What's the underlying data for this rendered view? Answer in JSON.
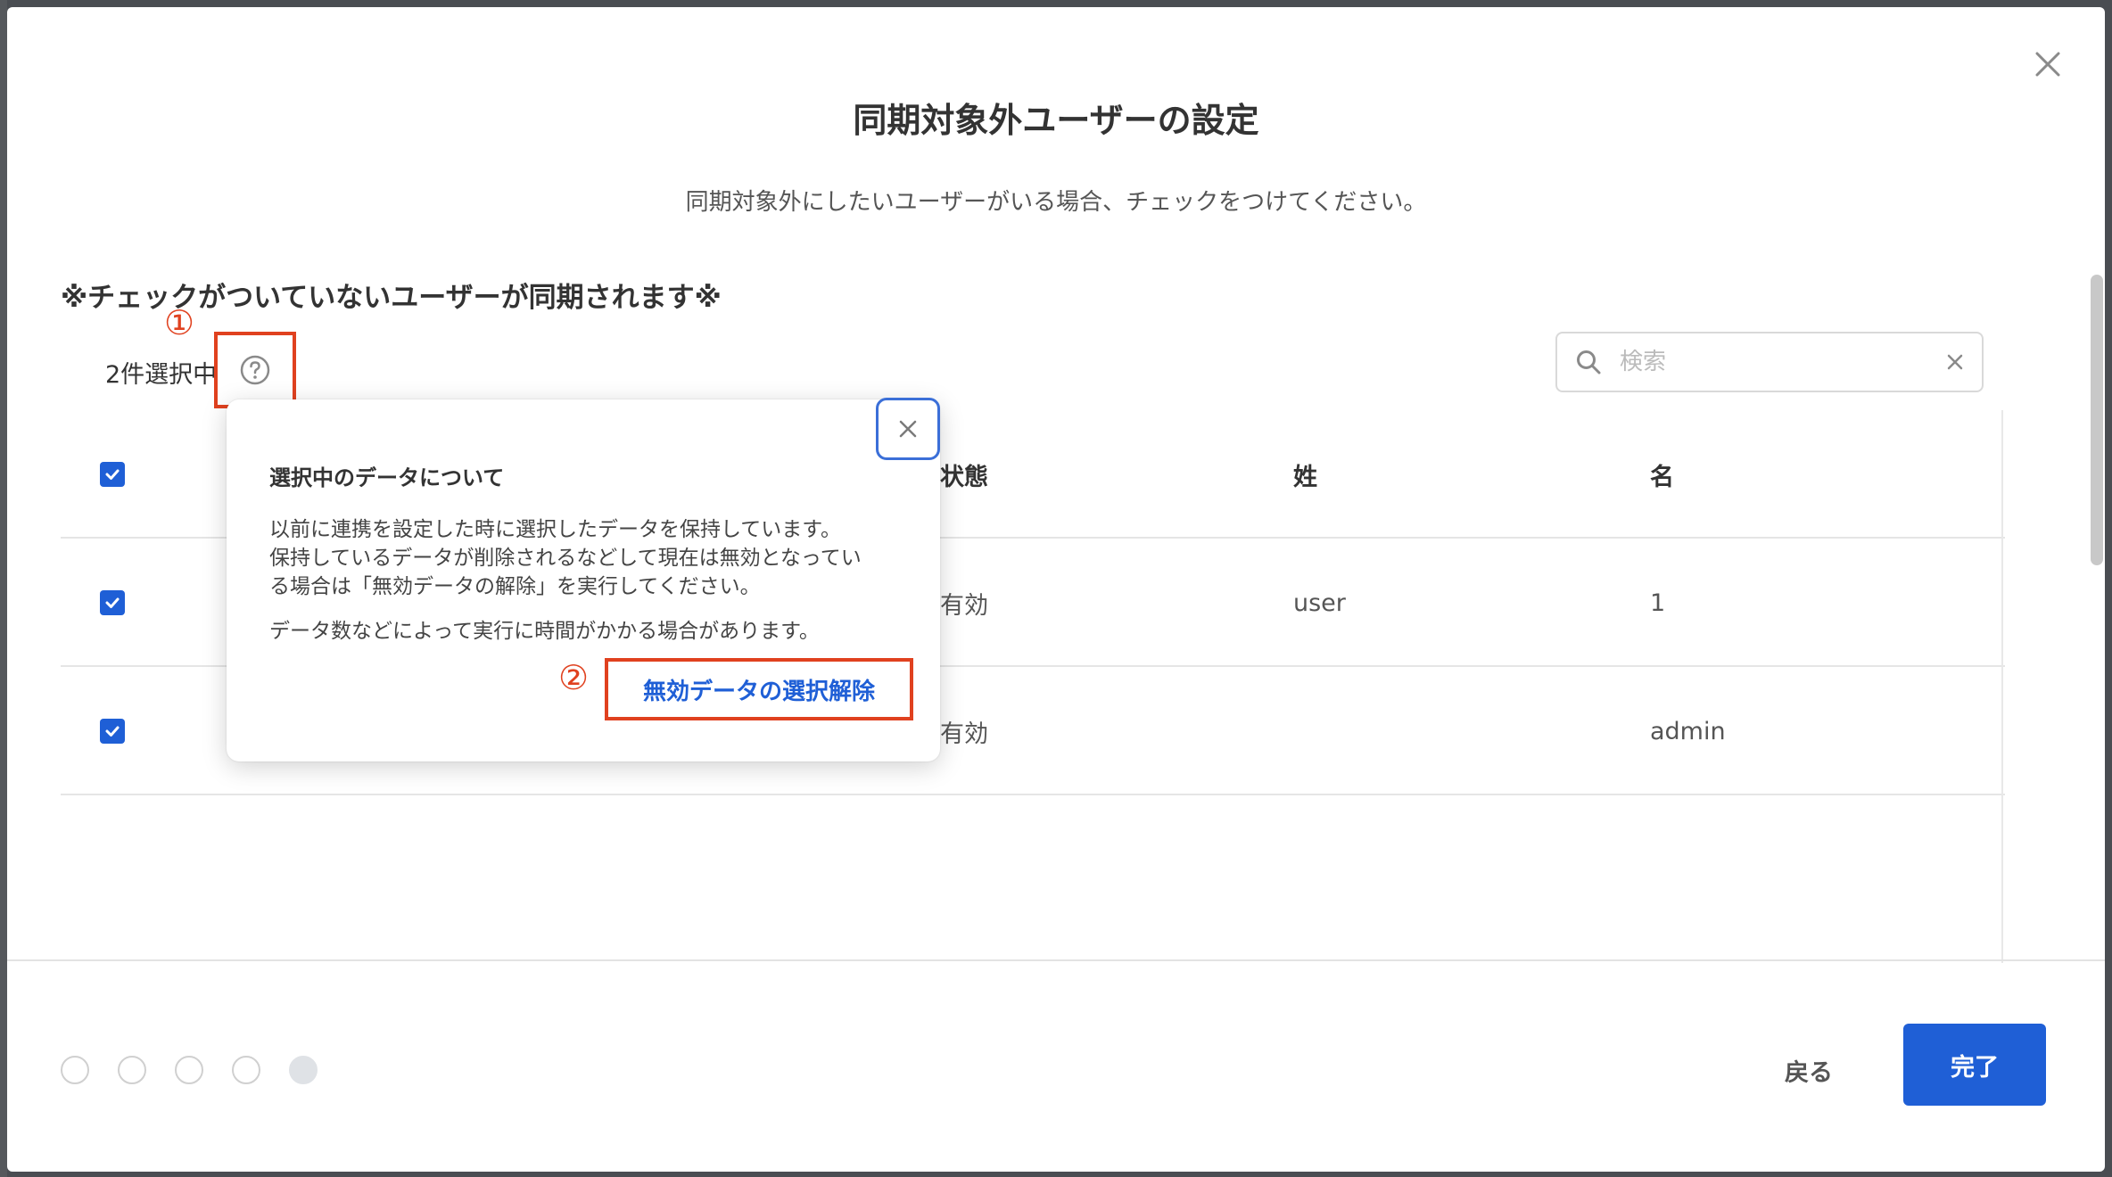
{
  "modal": {
    "title": "同期対象外ユーザーの設定",
    "subtitle": "同期対象外にしたいユーザーがいる場合、チェックをつけてください。",
    "notice": "※チェックがついていないユーザーが同期されます※"
  },
  "selection": {
    "count_label": "2件選択中",
    "annotation_1": "①"
  },
  "search": {
    "placeholder": "検索",
    "value": ""
  },
  "table": {
    "columns": {
      "status": "状態",
      "last_name": "姓",
      "first_name": "名"
    },
    "rows": [
      {
        "checked": true,
        "status": "有効",
        "last_name": "user",
        "first_name": "1"
      },
      {
        "checked": true,
        "status": "有効",
        "last_name": "",
        "first_name": "admin"
      }
    ]
  },
  "popover": {
    "title": "選択中のデータについて",
    "body_lines": [
      "以前に連携を設定した時に選択したデータを保持しています。",
      "保持しているデータが削除されるなどして現在は無効となってい",
      "る場合は「無効データの解除」を実行してください。"
    ],
    "note": "データ数などによって実行に時間がかかる場合があります。",
    "annotation_2": "②",
    "action_label": "無効データの選択解除"
  },
  "footer": {
    "steps_total": 5,
    "steps_current": 5,
    "back_label": "戻る",
    "done_label": "完了"
  },
  "colors": {
    "primary": "#1f5fd6",
    "annotation": "#e0411f",
    "popover_close_border": "#3b6fd8"
  },
  "icons": {
    "close": "close-icon",
    "help": "question-circle-icon",
    "search": "search-icon",
    "check": "check-icon"
  }
}
